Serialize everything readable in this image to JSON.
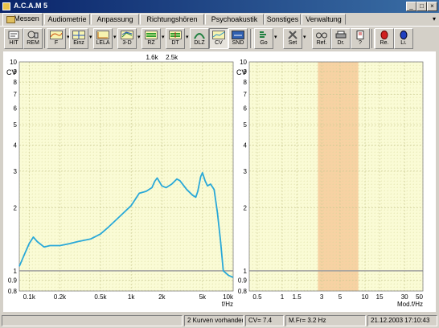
{
  "window": {
    "title": "A.C.A.M 5",
    "minimize": "_",
    "maximize": "□",
    "close": "×"
  },
  "tabs": [
    "Messen",
    "Audiometrie",
    "Anpassung",
    "Richtungshören",
    "Psychoakustik",
    "Sonstiges",
    "Verwaltung"
  ],
  "tab_dropdown": "▾",
  "toolbar": [
    {
      "label": "HIT",
      "icon": "hit-icon"
    },
    {
      "label": "REM",
      "icon": "rem-icon"
    },
    {
      "label": "F",
      "icon": "frequency-graph-icon",
      "dropdown": true
    },
    {
      "label": "Einz",
      "icon": "single-graph-icon",
      "dropdown": true
    },
    {
      "label": "LELA",
      "icon": "lela-graph-icon",
      "dropdown": true
    },
    {
      "label": "3-D",
      "icon": "3d-graph-icon",
      "dropdown": true
    },
    {
      "label": "RZ",
      "icon": "rz-graph-icon",
      "dropdown": true
    },
    {
      "label": "DT",
      "icon": "dt-graph-icon",
      "dropdown": true
    },
    {
      "label": "DLZ",
      "icon": "dlz-curve-icon"
    },
    {
      "label": "CV",
      "icon": "cv-graph-icon",
      "pressed": true
    },
    {
      "label": "SND",
      "icon": "sound-icon"
    },
    {
      "label": "Go",
      "icon": "go-icon",
      "dropdown": true
    },
    {
      "label": "Set",
      "icon": "settings-tools-icon",
      "dropdown": true
    },
    {
      "label": "Ref.",
      "icon": "reference-glasses-icon"
    },
    {
      "label": "Dr.",
      "icon": "printer-icon"
    },
    {
      "label": "?",
      "icon": "help-icon"
    },
    {
      "label": "Re.",
      "icon": "right-ear-icon"
    },
    {
      "label": "Li.",
      "icon": "left-ear-icon"
    }
  ],
  "chart_data": [
    {
      "type": "line",
      "ylabel": "CV",
      "xlabel": "f/Hz",
      "x_scale": "log",
      "y_scale": "log",
      "xlim": [
        80,
        10000
      ],
      "ylim": [
        0.8,
        10
      ],
      "x_ticks": [
        100,
        200,
        500,
        1000,
        2000,
        5000,
        10000
      ],
      "x_tick_labels": [
        "0.1k",
        "0.2k",
        "0.5k",
        "1k",
        "2k",
        "5k",
        "10k"
      ],
      "y_ticks": [
        0.8,
        0.9,
        1,
        2,
        3,
        4,
        5,
        6,
        7,
        8,
        9,
        10
      ],
      "y_tick_labels": [
        "0.8",
        "0.9",
        "1",
        "2",
        "3",
        "4",
        "5",
        "6",
        "7",
        "8",
        "9",
        "10"
      ],
      "top_markers": [
        {
          "x": 1600,
          "label": "1.6k"
        },
        {
          "x": 2500,
          "label": "2.5k"
        }
      ],
      "reference_line": 1,
      "grid": true,
      "series": [
        {
          "color": "#29a8d8",
          "x": [
            80,
            90,
            100,
            110,
            120,
            140,
            160,
            200,
            250,
            300,
            400,
            500,
            600,
            800,
            1000,
            1200,
            1400,
            1600,
            1700,
            1800,
            2000,
            2200,
            2500,
            2800,
            3000,
            3500,
            4000,
            4300,
            4500,
            4800,
            5000,
            5300,
            5600,
            6000,
            6500,
            7000,
            7500,
            8000,
            9000,
            10000
          ],
          "y": [
            1.05,
            1.2,
            1.35,
            1.45,
            1.38,
            1.3,
            1.32,
            1.32,
            1.35,
            1.38,
            1.42,
            1.5,
            1.62,
            1.85,
            2.05,
            2.35,
            2.4,
            2.5,
            2.68,
            2.78,
            2.55,
            2.5,
            2.6,
            2.75,
            2.7,
            2.45,
            2.3,
            2.25,
            2.4,
            2.82,
            2.95,
            2.7,
            2.55,
            2.6,
            2.45,
            1.9,
            1.4,
            1.0,
            0.95,
            0.93
          ]
        }
      ]
    },
    {
      "type": "line",
      "ylabel": "CV",
      "xlabel": "Mod.f/Hz",
      "x_scale": "log",
      "y_scale": "log",
      "xlim": [
        0.4,
        50
      ],
      "ylim": [
        0.8,
        10
      ],
      "x_ticks": [
        0.5,
        1,
        1.5,
        3,
        5,
        10,
        15,
        30,
        50
      ],
      "x_tick_labels": [
        "0.5",
        "1",
        "1.5",
        "3",
        "5",
        "10",
        "15",
        "30",
        "50"
      ],
      "y_ticks": [
        0.8,
        0.9,
        1,
        2,
        3,
        4,
        5,
        6,
        7,
        8,
        9,
        10
      ],
      "y_tick_labels": [
        "0.8",
        "0.9",
        "1",
        "2",
        "3",
        "4",
        "5",
        "6",
        "7",
        "8",
        "9",
        "10"
      ],
      "reference_line": 1,
      "highlight_band": [
        2.7,
        8.3
      ],
      "grid": true,
      "series": []
    }
  ],
  "status": {
    "curves": "2 Kurven vorhanden",
    "cv": "CV= 7.4",
    "mfr": "M.Fr= 3.2 Hz",
    "datetime": "21.12.2003 17:10:43"
  },
  "colors": {
    "title_start": "#0a246a",
    "title_end": "#3a6ea5",
    "plot_bg": "#fafbd5",
    "grid": "#d6d69a",
    "curve": "#29a8d8",
    "band": "#f7d2a3",
    "refline": "#a0a0a0"
  }
}
